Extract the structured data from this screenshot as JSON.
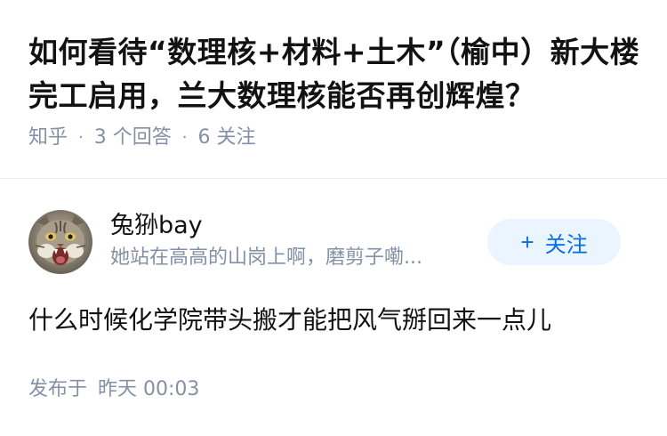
{
  "question": {
    "title": "如何看待“数理核+材料+土木”（榆中）新大楼完工启用，兰大数理核能否再创辉煌？",
    "source": "知乎",
    "separator": "·",
    "answers_count": "3 个回答",
    "followers_count": "6 关注"
  },
  "author": {
    "name": "兔狲bay",
    "bio": "她站在高高的山岗上啊，磨剪子嘞...",
    "follow_plus": "+",
    "follow_label": "关注"
  },
  "answer": {
    "content": "什么时候化学院带头搬才能把风气掰回来一点儿",
    "published_label": "发布于",
    "published_time": "昨天 00:03"
  },
  "colors": {
    "text_primary": "#121212",
    "text_secondary": "#8590a6",
    "accent": "#056de8",
    "accent_bg": "#ebf5ff",
    "divider": "#ebebeb"
  }
}
